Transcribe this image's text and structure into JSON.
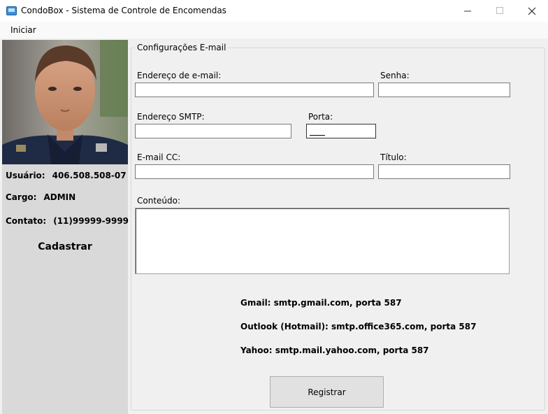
{
  "window": {
    "title": "CondoBox - Sistema de Controle de Encomendas"
  },
  "menu": {
    "iniciar": "Iniciar"
  },
  "sidebar": {
    "usuario_label": "Usuário:",
    "usuario_value": "406.508.508-07",
    "cargo_label": "Cargo:",
    "cargo_value": "ADMIN",
    "contato_label": "Contato:",
    "contato_value": "(11)99999-9999",
    "cadastrar": "Cadastrar"
  },
  "form": {
    "group_title": "Configurações E-mail",
    "email_label": "Endereço de e-mail:",
    "email_value": "",
    "senha_label": "Senha:",
    "senha_value": "",
    "smtp_label": "Endereço SMTP:",
    "smtp_value": "",
    "porta_label": "Porta:",
    "porta_value": "",
    "cc_label": "E-mail CC:",
    "cc_value": "",
    "titulo_label": "Título:",
    "titulo_value": "",
    "conteudo_label": "Conteúdo:",
    "conteudo_value": ""
  },
  "hints": {
    "gmail": "Gmail: smtp.gmail.com, porta 587",
    "outlook": "Outlook (Hotmail): smtp.office365.com, porta 587",
    "yahoo": "Yahoo: smtp.mail.yahoo.com, porta 587"
  },
  "buttons": {
    "registrar": "Registrar"
  },
  "icons": {
    "app": "condobox-app-icon",
    "minimize": "minimize-icon",
    "maximize": "maximize-icon",
    "close": "close-icon",
    "user_photo": "user-photo"
  }
}
